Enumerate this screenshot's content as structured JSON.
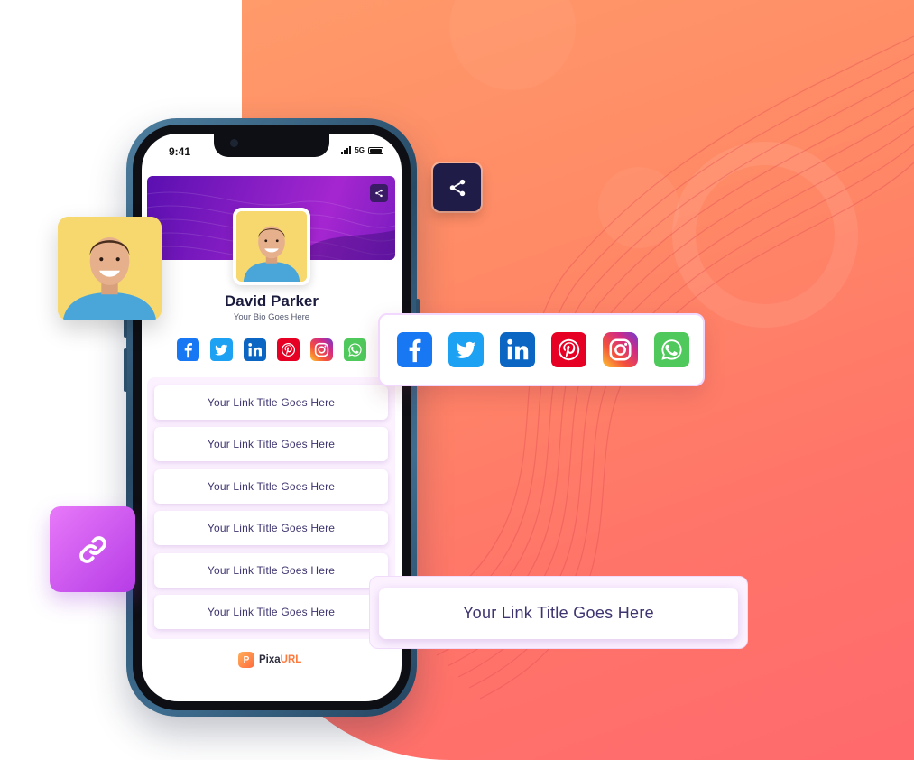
{
  "status_bar": {
    "time": "9:41",
    "network": "5G"
  },
  "profile": {
    "name": "David Parker",
    "bio": "Your Bio Goes Here",
    "avatar": "smiling-man-portrait"
  },
  "social_icons": [
    "facebook-icon",
    "twitter-icon",
    "linkedin-icon",
    "pinterest-icon",
    "instagram-icon",
    "whatsapp-icon"
  ],
  "links": [
    {
      "label": "Your Link Title Goes Here"
    },
    {
      "label": "Your Link Title Goes Here"
    },
    {
      "label": "Your Link Title Goes Here"
    },
    {
      "label": "Your Link Title Goes Here"
    },
    {
      "label": "Your Link Title Goes Here"
    },
    {
      "label": "Your Link Title Goes Here"
    }
  ],
  "branding": {
    "logo_letter": "P",
    "name_part1": "Pixa",
    "name_part2": "URL"
  },
  "floating": {
    "link_button_label": "Your Link Title Goes Here",
    "share_icon": "share-icon",
    "link_icon": "link-icon"
  },
  "colors": {
    "background_orange": "#ff8a66",
    "banner_purple": "#8b1fc6",
    "share_dark": "#1f1c48",
    "link_icon_gradient": "#d05cf0",
    "text_dark": "#1a1b3d",
    "link_text": "#3d3470",
    "brand_orange": "#ff7a3d"
  }
}
